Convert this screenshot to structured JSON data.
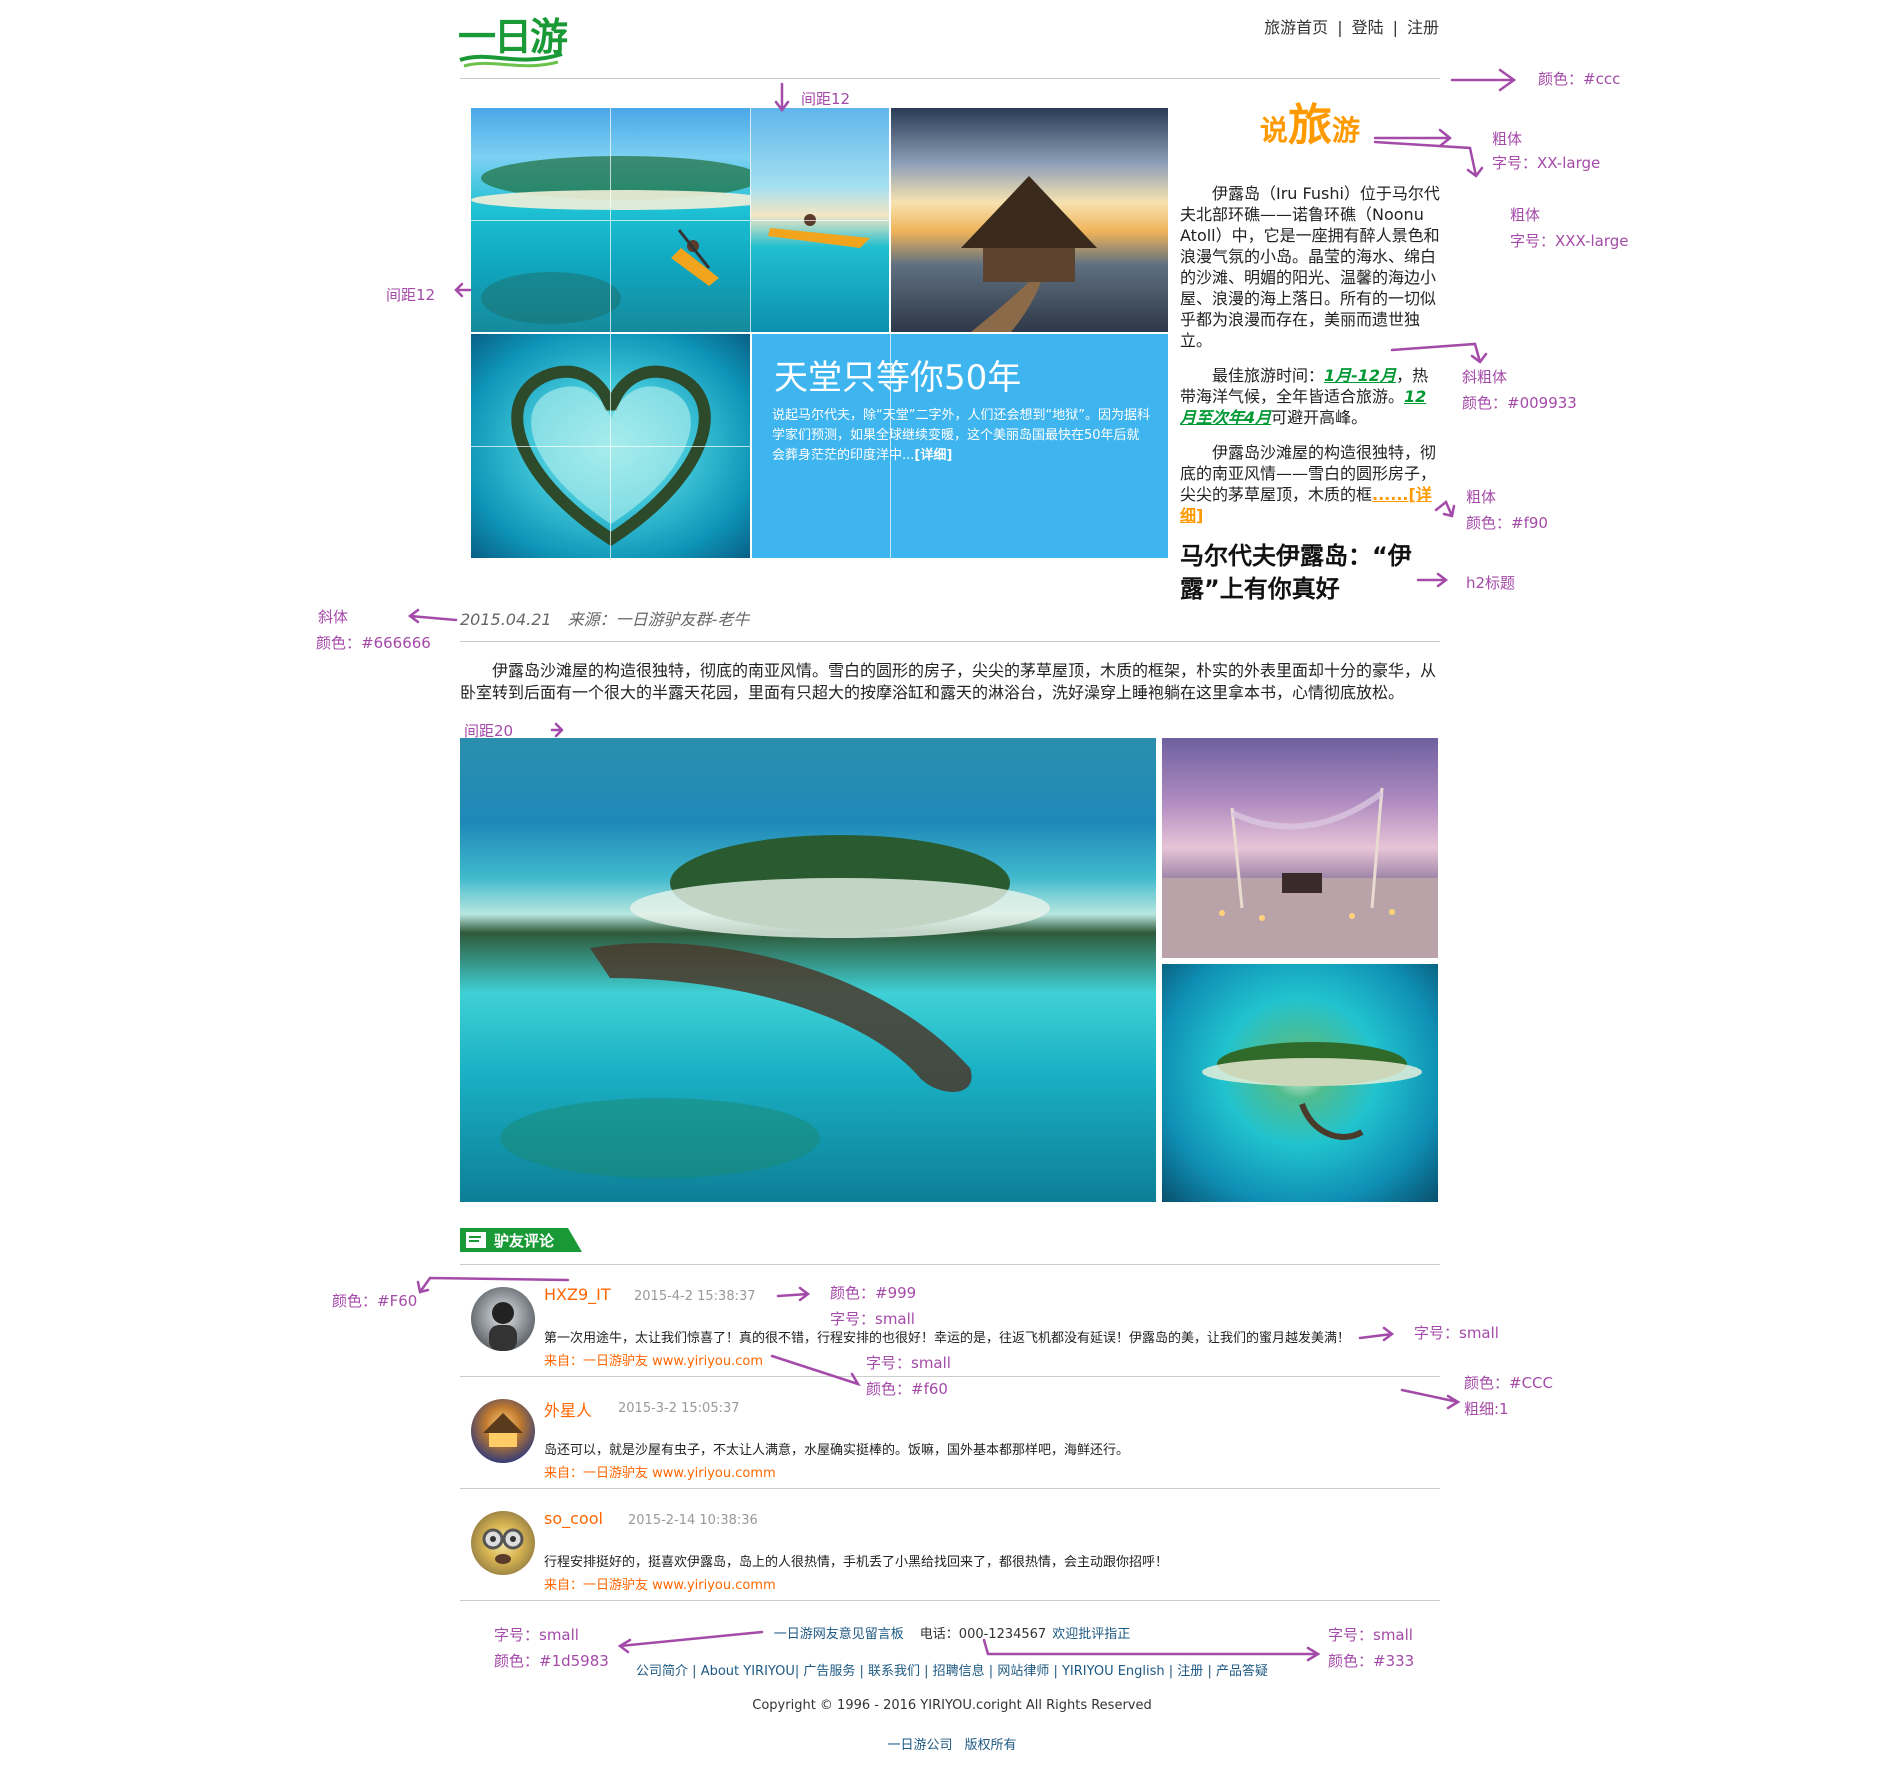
{
  "header": {
    "logo_text": "一日游",
    "nav": [
      "旅游首页",
      "登陆",
      "注册"
    ],
    "nav_sep": "|"
  },
  "hero": {
    "title": "天堂只等你50年",
    "text": "说起马尔代夫，除“天堂”二字外，人们还会想到“地狱”。因为据科学家们预测，如果全球继续变暖，这个美丽岛国最快在50年后就会葬身茫茫的印度洋中...",
    "more": "[详细]"
  },
  "sidebar": {
    "heading_parts": [
      "说",
      "旅",
      "游"
    ],
    "p1": "伊露岛（Iru Fushi）位于马尔代夫北部环礁——诺鲁环礁（Noonu Atoll）中，它是一座拥有醉人景色和浪漫气氛的小岛。晶莹的海水、绵白的沙滩、明媚的阳光、温馨的海边小屋、浪漫的海上落日。所有的一切似乎都为浪漫而存在，美丽而遗世独立。",
    "p2_prefix": "最佳旅游时间：",
    "p2_green1": "1月-12月",
    "p2_mid": "，热带海洋气候，全年皆适合旅游。",
    "p2_green2": "12月至次年4月",
    "p2_suffix": "可避开高峰。",
    "p3": "伊露岛沙滩屋的构造很独特，彻底的南亚风情——雪白的圆形房子，尖尖的茅草屋顶，木质的框",
    "p3_more": "......[详细]",
    "h2": "马尔代夫伊露岛：“伊露”上有你真好"
  },
  "article": {
    "date": "2015.04.21",
    "source": "来源：一日游驴友群-老牛",
    "paragraph": "伊露岛沙滩屋的构造很独特，彻底的南亚风情。雪白的圆形的房子，尖尖的茅草屋顶，木质的框架，朴实的外表里面却十分的豪华，从卧室转到后面有一个很大的半露天花园，里面有只超大的按摩浴缸和露天的淋浴台，洗好澡穿上睡袍躺在这里拿本书，心情彻底放松。"
  },
  "comments": {
    "heading": "驴友评论",
    "items": [
      {
        "name": "HXZ9_IT",
        "time": "2015-4-2 15:38:37",
        "text": "第一次用途牛，太让我们惊喜了！真的很不错，行程安排的也很好！幸运的是，往返飞机都没有延误！伊露岛的美，让我们的蜜月越发美满！",
        "source": "来自：一日游驴友 www.yiriyou.com"
      },
      {
        "name": "外星人",
        "time": "2015-3-2 15:05:37",
        "text": "岛还可以，就是沙屋有虫子，不太让人满意，水屋确实挺棒的。饭嘛，国外基本都那样吧，海鲜还行。",
        "source": "来自：一日游驴友 www.yiriyou.comm"
      },
      {
        "name": "so_cool",
        "time": "2015-2-14 10:38:36",
        "text": "行程安排挺好的，挺喜欢伊露岛，岛上的人很热情，手机丢了小黑给找回来了，都很热情，会主动跟你招呼！",
        "source": "来自：一日游驴友 www.yiriyou.comm"
      }
    ]
  },
  "footer": {
    "board": "一日游网友意见留言板",
    "phone": "电话：000-1234567",
    "feedback": "欢迎批评指正",
    "links": "公司简介 | About YIRIYOU| 广告服务 | 联系我们 | 招聘信息 | 网站律师 | YIRIYOU English | 注册 | 产品答疑",
    "copyright": "Copyright © 1996 - 2016 YIRIYOU.coright All Rights Reserved",
    "company": "一日游公司",
    "rights": "版权所有"
  },
  "annotations": {
    "color_ccc": "颜色：#ccc",
    "spacing12_top": "间距12",
    "spacing12_left": "间距12",
    "bold1": "粗体",
    "size_xx": "字号：XX-large",
    "bold2": "粗体",
    "size_xxx": "字号：XXX-large",
    "bold_italic": "斜粗体",
    "color_009933": "颜色：#009933",
    "bold3": "粗体",
    "color_f90": "颜色：#f90",
    "h2_title": "h2标题",
    "italic": "斜体",
    "color_666": "颜色：#666666",
    "spacing20": "间距20",
    "color_F60": "颜色：#F60",
    "color_999": "颜色：#999",
    "size_small1": "字号：small",
    "size_small2": "字号：small",
    "size_small3": "字号：small",
    "color_f60": "颜色：#f60",
    "color_CCC": "颜色：#CCC",
    "thickness": "粗细:1",
    "size_small4": "字号：small",
    "color_1d5983": "颜色：#1d5983",
    "size_small5": "字号：small",
    "color_333": "颜色：#333"
  },
  "colors": {
    "accent_orange": "#f90",
    "green": "#009933",
    "name_orange": "#F60",
    "link_blue": "#1d5983",
    "divider": "#ccc",
    "hero_blue": "#3fb5ef",
    "annotation_purple": "#a44aa8"
  }
}
